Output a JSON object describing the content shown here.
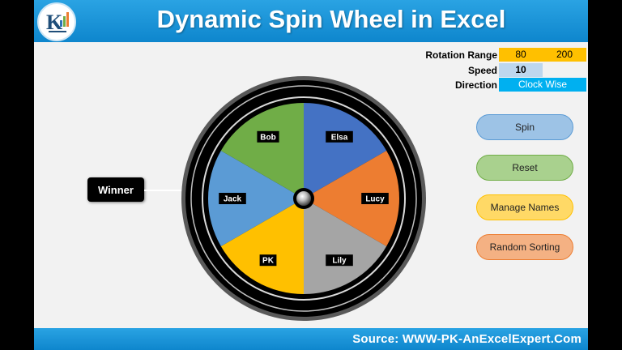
{
  "header": {
    "title": "Dynamic Spin Wheel in Excel"
  },
  "params": {
    "rotation_range": {
      "label": "Rotation Range",
      "min": "80",
      "max": "200"
    },
    "speed": {
      "label": "Speed",
      "value": "10"
    },
    "direction": {
      "label": "Direction",
      "value": "Clock Wise"
    }
  },
  "buttons": {
    "spin": "Spin",
    "reset": "Reset",
    "manage_names": "Manage Names",
    "random_sorting": "Random Sorting"
  },
  "winner_label": "Winner",
  "wheel": {
    "segments": [
      {
        "name": "Elsa",
        "color": "#4472c4"
      },
      {
        "name": "Lucy",
        "color": "#ed7d31"
      },
      {
        "name": "Lily",
        "color": "#a5a5a5"
      },
      {
        "name": "PK",
        "color": "#ffc000"
      },
      {
        "name": "Jack",
        "color": "#5b9bd5"
      },
      {
        "name": "Bob",
        "color": "#70ad47"
      }
    ]
  },
  "footer": {
    "source": "Source: WWW-PK-AnExcelExpert.Com"
  }
}
